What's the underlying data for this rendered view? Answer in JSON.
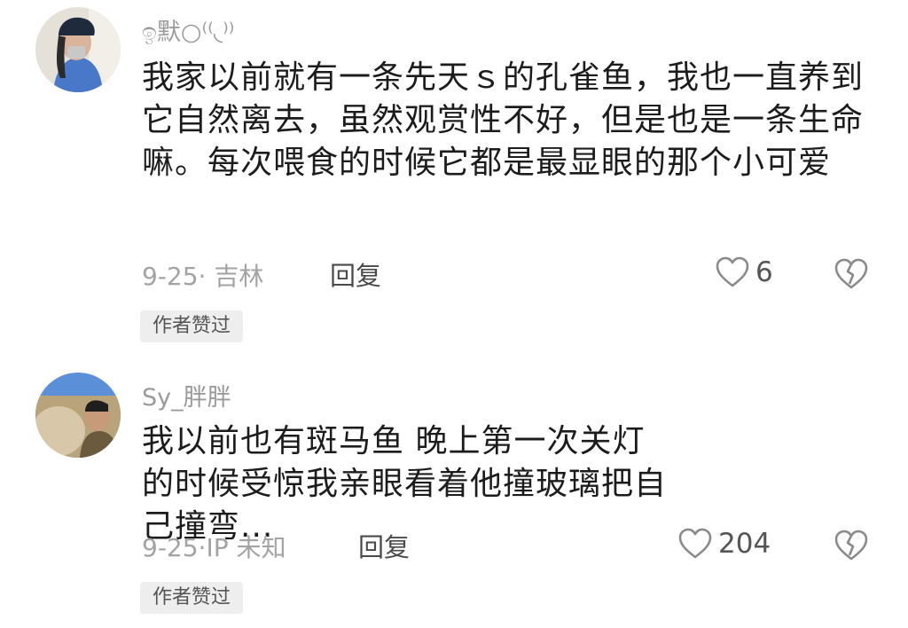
{
  "comments": [
    {
      "username": "ඉ默○⁽⁽◟⁾⁾",
      "text": "我家以前就有一条先天ｓ的孔雀鱼，我也一直养到它自然离去，虽然观赏性不好，但是也是一条生命嘛。每次喂食的时候它都是最显眼的那个小可爱",
      "meta": "9-25· 吉林",
      "reply_label": "回复",
      "likes": "6",
      "badge": "作者赞过"
    },
    {
      "username": "Sy_胖胖",
      "text": "我以前也有斑马鱼 晚上第一次关灯的时候受惊我亲眼看着他撞玻璃把自己撞弯...",
      "meta": "9-25·IP 未知",
      "reply_label": "回复",
      "likes": "204",
      "badge": "作者赞过"
    }
  ],
  "icons": {
    "like": "heart-outline-icon",
    "dislike": "broken-heart-icon"
  },
  "colors": {
    "meta_gray": "#a3a3a3",
    "badge_bg": "#eeeeee",
    "icon_gray": "#8a8a8a"
  }
}
